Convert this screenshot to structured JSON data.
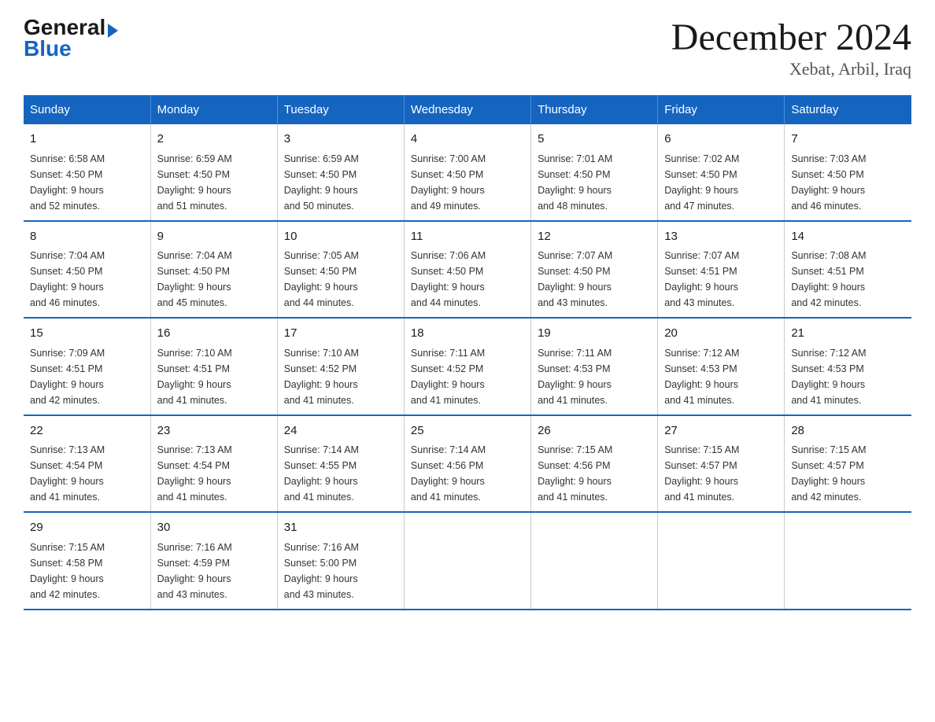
{
  "logo": {
    "general": "General",
    "arrow": "▶",
    "blue": "Blue"
  },
  "title": "December 2024",
  "location": "Xebat, Arbil, Iraq",
  "weekdays": [
    "Sunday",
    "Monday",
    "Tuesday",
    "Wednesday",
    "Thursday",
    "Friday",
    "Saturday"
  ],
  "weeks": [
    [
      {
        "day": "1",
        "sunrise": "6:58 AM",
        "sunset": "4:50 PM",
        "daylight": "9 hours and 52 minutes."
      },
      {
        "day": "2",
        "sunrise": "6:59 AM",
        "sunset": "4:50 PM",
        "daylight": "9 hours and 51 minutes."
      },
      {
        "day": "3",
        "sunrise": "6:59 AM",
        "sunset": "4:50 PM",
        "daylight": "9 hours and 50 minutes."
      },
      {
        "day": "4",
        "sunrise": "7:00 AM",
        "sunset": "4:50 PM",
        "daylight": "9 hours and 49 minutes."
      },
      {
        "day": "5",
        "sunrise": "7:01 AM",
        "sunset": "4:50 PM",
        "daylight": "9 hours and 48 minutes."
      },
      {
        "day": "6",
        "sunrise": "7:02 AM",
        "sunset": "4:50 PM",
        "daylight": "9 hours and 47 minutes."
      },
      {
        "day": "7",
        "sunrise": "7:03 AM",
        "sunset": "4:50 PM",
        "daylight": "9 hours and 46 minutes."
      }
    ],
    [
      {
        "day": "8",
        "sunrise": "7:04 AM",
        "sunset": "4:50 PM",
        "daylight": "9 hours and 46 minutes."
      },
      {
        "day": "9",
        "sunrise": "7:04 AM",
        "sunset": "4:50 PM",
        "daylight": "9 hours and 45 minutes."
      },
      {
        "day": "10",
        "sunrise": "7:05 AM",
        "sunset": "4:50 PM",
        "daylight": "9 hours and 44 minutes."
      },
      {
        "day": "11",
        "sunrise": "7:06 AM",
        "sunset": "4:50 PM",
        "daylight": "9 hours and 44 minutes."
      },
      {
        "day": "12",
        "sunrise": "7:07 AM",
        "sunset": "4:50 PM",
        "daylight": "9 hours and 43 minutes."
      },
      {
        "day": "13",
        "sunrise": "7:07 AM",
        "sunset": "4:51 PM",
        "daylight": "9 hours and 43 minutes."
      },
      {
        "day": "14",
        "sunrise": "7:08 AM",
        "sunset": "4:51 PM",
        "daylight": "9 hours and 42 minutes."
      }
    ],
    [
      {
        "day": "15",
        "sunrise": "7:09 AM",
        "sunset": "4:51 PM",
        "daylight": "9 hours and 42 minutes."
      },
      {
        "day": "16",
        "sunrise": "7:10 AM",
        "sunset": "4:51 PM",
        "daylight": "9 hours and 41 minutes."
      },
      {
        "day": "17",
        "sunrise": "7:10 AM",
        "sunset": "4:52 PM",
        "daylight": "9 hours and 41 minutes."
      },
      {
        "day": "18",
        "sunrise": "7:11 AM",
        "sunset": "4:52 PM",
        "daylight": "9 hours and 41 minutes."
      },
      {
        "day": "19",
        "sunrise": "7:11 AM",
        "sunset": "4:53 PM",
        "daylight": "9 hours and 41 minutes."
      },
      {
        "day": "20",
        "sunrise": "7:12 AM",
        "sunset": "4:53 PM",
        "daylight": "9 hours and 41 minutes."
      },
      {
        "day": "21",
        "sunrise": "7:12 AM",
        "sunset": "4:53 PM",
        "daylight": "9 hours and 41 minutes."
      }
    ],
    [
      {
        "day": "22",
        "sunrise": "7:13 AM",
        "sunset": "4:54 PM",
        "daylight": "9 hours and 41 minutes."
      },
      {
        "day": "23",
        "sunrise": "7:13 AM",
        "sunset": "4:54 PM",
        "daylight": "9 hours and 41 minutes."
      },
      {
        "day": "24",
        "sunrise": "7:14 AM",
        "sunset": "4:55 PM",
        "daylight": "9 hours and 41 minutes."
      },
      {
        "day": "25",
        "sunrise": "7:14 AM",
        "sunset": "4:56 PM",
        "daylight": "9 hours and 41 minutes."
      },
      {
        "day": "26",
        "sunrise": "7:15 AM",
        "sunset": "4:56 PM",
        "daylight": "9 hours and 41 minutes."
      },
      {
        "day": "27",
        "sunrise": "7:15 AM",
        "sunset": "4:57 PM",
        "daylight": "9 hours and 41 minutes."
      },
      {
        "day": "28",
        "sunrise": "7:15 AM",
        "sunset": "4:57 PM",
        "daylight": "9 hours and 42 minutes."
      }
    ],
    [
      {
        "day": "29",
        "sunrise": "7:15 AM",
        "sunset": "4:58 PM",
        "daylight": "9 hours and 42 minutes."
      },
      {
        "day": "30",
        "sunrise": "7:16 AM",
        "sunset": "4:59 PM",
        "daylight": "9 hours and 43 minutes."
      },
      {
        "day": "31",
        "sunrise": "7:16 AM",
        "sunset": "5:00 PM",
        "daylight": "9 hours and 43 minutes."
      },
      null,
      null,
      null,
      null
    ]
  ],
  "labels": {
    "sunrise": "Sunrise:",
    "sunset": "Sunset:",
    "daylight": "Daylight:"
  }
}
